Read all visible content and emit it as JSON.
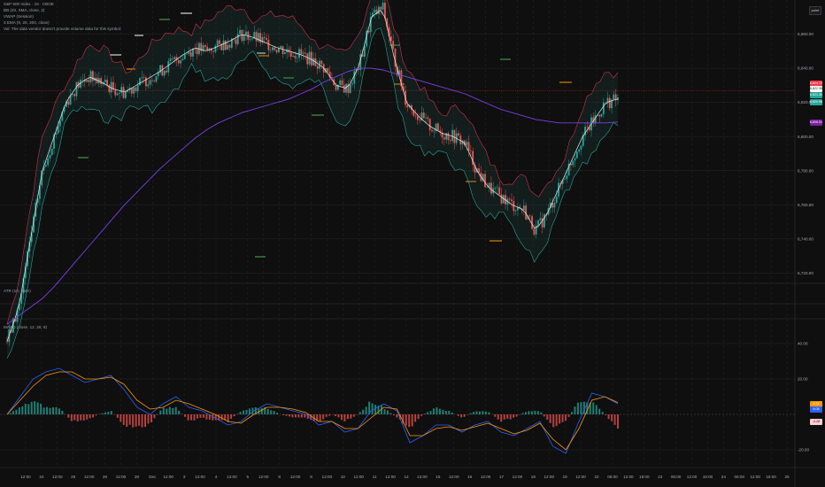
{
  "header": {
    "symbol_line": "S&P 500 Index · 15 · CBOE",
    "indicator_lines": [
      "BB (20, SMA, close, 2)",
      "VWAP (Session)",
      "3 EMA (9, 20, 200, close)",
      "Vol: The data vendor doesn't provide volume data for this symbol."
    ],
    "unit_badge": "point"
  },
  "panes": {
    "atr_title": "ATR (10, SMA)",
    "macd_title": "MACD (close, 12, 26, 9)"
  },
  "price_axis": {
    "ticks": [
      "6,860.00",
      "6,840.00",
      "6,820.00",
      "6,800.00",
      "6,780.00",
      "6,760.00",
      "6,740.00",
      "6,720.00"
    ],
    "values": [
      6860,
      6840,
      6820,
      6800,
      6780,
      6760,
      6740,
      6720
    ]
  },
  "macd_axis": {
    "ticks": [
      "40.00",
      "20.00",
      "-20.00"
    ],
    "values": [
      40,
      20,
      -20
    ]
  },
  "price_tags": [
    {
      "text": "6,824.72",
      "color": "#f23645",
      "value": 6831
    },
    {
      "text": "6,822.38",
      "color": "#ffffff",
      "value": 6828
    },
    {
      "text": "6,821.30",
      "color": "#26a69a",
      "value": 6824
    },
    {
      "text": "6,820.96",
      "color": "#26a69a",
      "value": 6820
    },
    {
      "text": "6,808.51",
      "color": "#7b1fa2",
      "value": 6808
    }
  ],
  "macd_tags": [
    {
      "text": "6.74",
      "color": "#ff9800",
      "value": 6
    },
    {
      "text": "6.08",
      "color": "#2962ff",
      "value": 3
    },
    {
      "text": "-4.28",
      "color": "#ffcdd2",
      "value": -4
    }
  ],
  "time_axis": {
    "labels": [
      "12:00",
      "24",
      "12:00",
      "25",
      "12:00",
      "26",
      "12:00",
      "28",
      "Dec",
      "12:00",
      "3",
      "12:00",
      "4",
      "12:00",
      "5",
      "12:00",
      "8",
      "12:00",
      "9",
      "12:00",
      "10",
      "12:00",
      "11",
      "12:00",
      "12",
      "12:00",
      "15",
      "12:00",
      "16",
      "12:00",
      "17",
      "12:00",
      "18",
      "12:00",
      "19",
      "12:00",
      "22",
      "06:00",
      "12:00",
      "18:00",
      "23",
      "06:00",
      "12:00",
      "18:00",
      "24",
      "06:00",
      "12:00",
      "18:00",
      "25"
    ]
  },
  "colors": {
    "bull": "#26a69a",
    "bear": "#ef5350",
    "bb_band": "#d03050",
    "bb_lower": "#26a69a",
    "vwap": "#ffffff",
    "ema200": "#7b3fe4",
    "macd_line": "#2962ff",
    "signal_line": "#ff9800",
    "grid": "#262629"
  },
  "chart_data": {
    "type": "line",
    "title": "S&P 500 Index · 15 · CBOE",
    "ylim": [
      6715,
      6880
    ],
    "series": [
      {
        "name": "Close",
        "values": [
          6680,
          6700,
          6740,
          6780,
          6800,
          6820,
          6830,
          6835,
          6832,
          6828,
          6826,
          6830,
          6834,
          6838,
          6843,
          6848,
          6852,
          6850,
          6853,
          6856,
          6860,
          6858,
          6855,
          6852,
          6850,
          6848,
          6845,
          6840,
          6830,
          6828,
          6842,
          6870,
          6875,
          6845,
          6820,
          6812,
          6806,
          6802,
          6800,
          6796,
          6780,
          6770,
          6765,
          6760,
          6757,
          6745,
          6755,
          6770,
          6785,
          6800,
          6810,
          6820,
          6822
        ]
      },
      {
        "name": "EMA 200",
        "values": [
          6690,
          6695,
          6700,
          6705,
          6712,
          6720,
          6728,
          6736,
          6744,
          6752,
          6760,
          6767,
          6774,
          6781,
          6787,
          6793,
          6799,
          6804,
          6808,
          6811,
          6814,
          6816,
          6818,
          6820,
          6822,
          6825,
          6828,
          6832,
          6835,
          6838,
          6840,
          6840,
          6839,
          6837,
          6835,
          6833,
          6831,
          6829,
          6827,
          6825,
          6822,
          6819,
          6816,
          6814,
          6812,
          6810,
          6809,
          6808,
          6808,
          6808,
          6808,
          6808,
          6808.5
        ]
      }
    ],
    "macd": {
      "macd_line": [
        0,
        10,
        20,
        24,
        26,
        22,
        18,
        20,
        22,
        14,
        4,
        0,
        6,
        10,
        4,
        2,
        -2,
        -6,
        -4,
        2,
        6,
        4,
        2,
        0,
        -6,
        -4,
        -10,
        -8,
        2,
        6,
        2,
        -16,
        -12,
        -6,
        -6,
        -10,
        -6,
        -4,
        -10,
        -12,
        -8,
        -4,
        -18,
        -22,
        -4,
        12,
        10,
        6
      ],
      "signal_line": [
        0,
        8,
        16,
        22,
        24,
        24,
        20,
        20,
        21,
        17,
        8,
        3,
        4,
        8,
        6,
        3,
        0,
        -4,
        -5,
        0,
        4,
        4,
        3,
        1,
        -4,
        -4,
        -8,
        -8,
        -2,
        4,
        3,
        -12,
        -12,
        -8,
        -7,
        -9,
        -7,
        -5,
        -8,
        -11,
        -9,
        -5,
        -14,
        -20,
        -8,
        8,
        10,
        6.7
      ],
      "histogram": [
        0,
        2,
        4,
        2,
        2,
        -2,
        -2,
        0,
        1,
        -3,
        -4,
        -3,
        2,
        2,
        -2,
        -1,
        -2,
        -2,
        1,
        2,
        2,
        0,
        -1,
        -1,
        -2,
        0,
        -2,
        0,
        4,
        2,
        -1,
        -4,
        0,
        2,
        1,
        -1,
        1,
        1,
        -2,
        -1,
        1,
        1,
        -4,
        -2,
        4,
        4,
        0,
        -4.3
      ]
    },
    "macd_ylim": [
      -26,
      48
    ]
  }
}
